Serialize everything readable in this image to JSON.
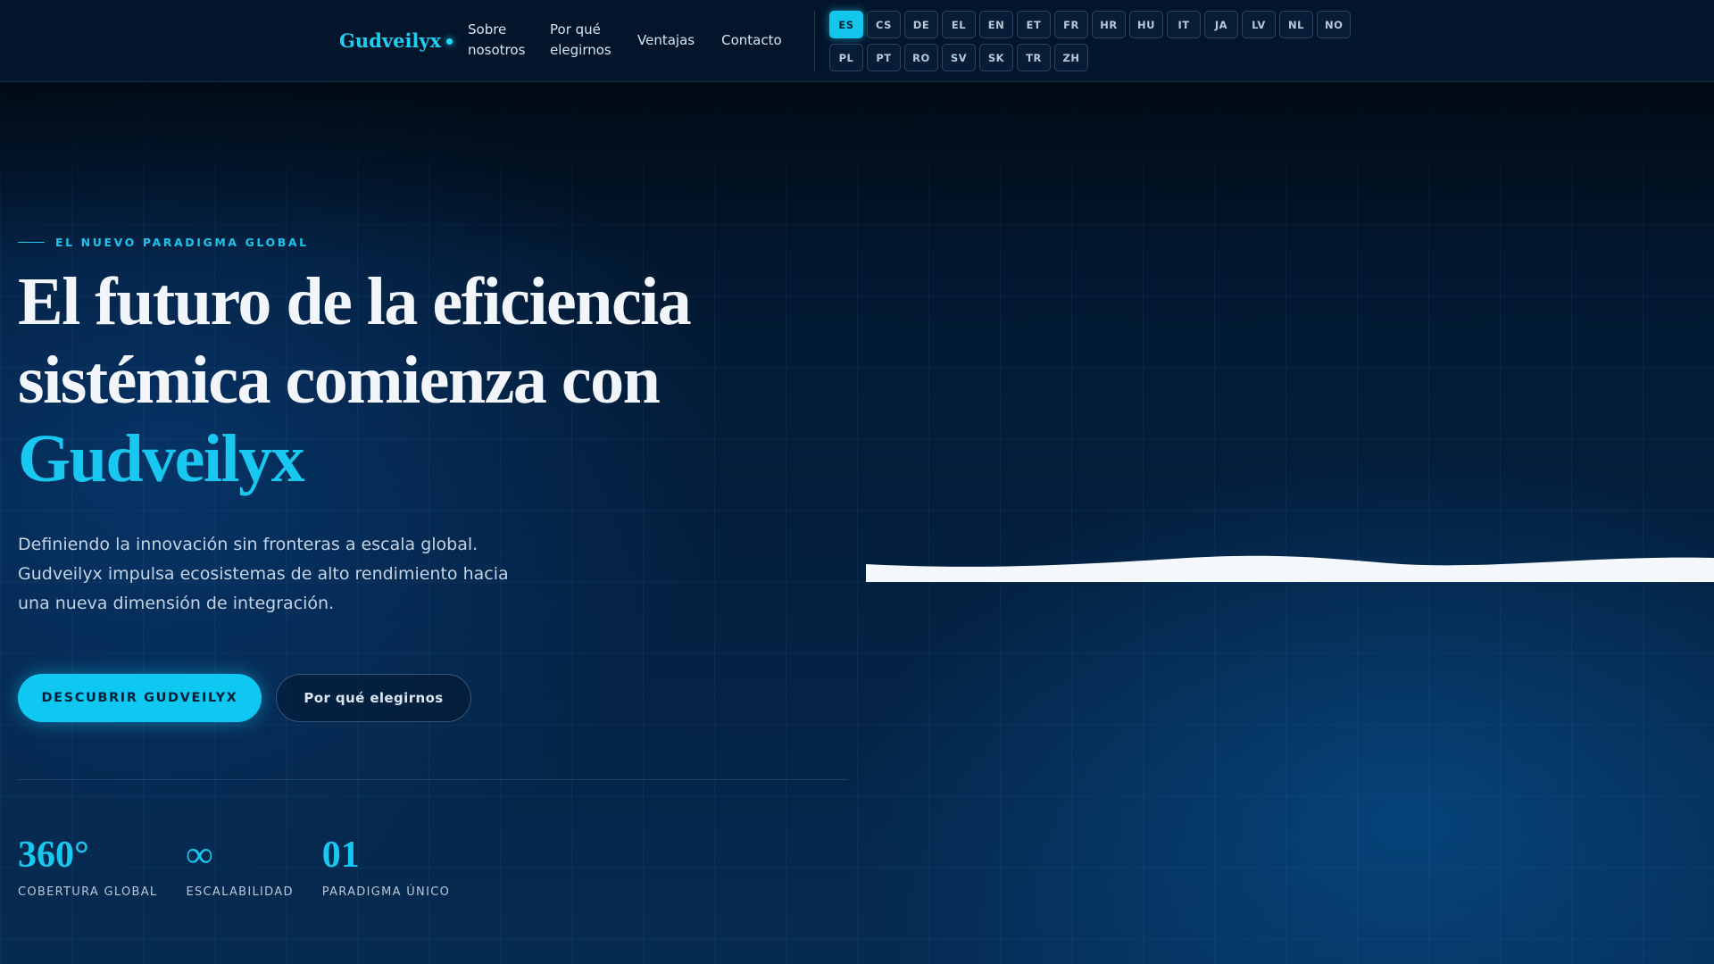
{
  "header": {
    "brand": "Gudveilyx",
    "nav": [
      {
        "label": "Sobre nosotros"
      },
      {
        "label": "Por qué elegirnos"
      },
      {
        "label": "Ventajas"
      },
      {
        "label": "Contacto"
      }
    ],
    "languages": [
      "ES",
      "CS",
      "DE",
      "EL",
      "EN",
      "ET",
      "FR",
      "HR",
      "HU",
      "IT",
      "JA",
      "LV",
      "NL",
      "NO",
      "PL",
      "PT",
      "RO",
      "SV",
      "SK",
      "TR",
      "ZH"
    ],
    "active_language": "ES"
  },
  "hero": {
    "eyebrow": "EL NUEVO PARADIGMA GLOBAL",
    "headline_line1": "El futuro de la eficiencia",
    "headline_line2": "sistémica comienza con",
    "headline_accent": "Gudveilyx",
    "lede": "Definiendo la innovación sin fronteras a escala global. Gudveilyx impulsa ecosistemas de alto rendimiento hacia una nueva dimensión de integración.",
    "primary_cta": "DESCUBRIR GUDVEILYX",
    "secondary_cta": "Por qué elegirnos"
  },
  "stats": [
    {
      "value": "360°",
      "label": "COBERTURA GLOBAL"
    },
    {
      "value": "∞",
      "label": "ESCALABILIDAD"
    },
    {
      "value": "01",
      "label": "PARADIGMA ÚNICO"
    }
  ],
  "colors": {
    "accent": "#18c8f0",
    "background": "#021428",
    "active_language_bg": "#12c6ec"
  }
}
